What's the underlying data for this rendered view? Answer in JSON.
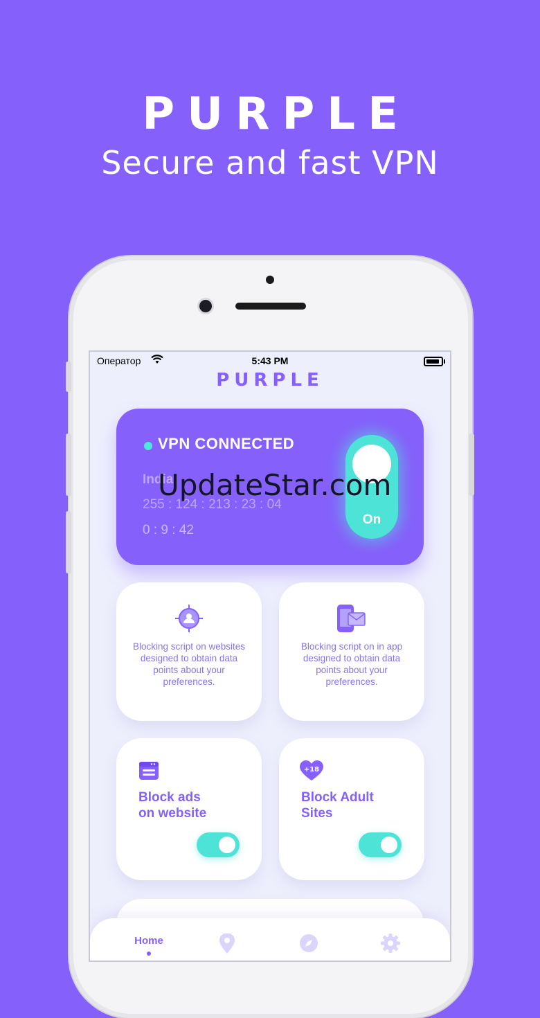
{
  "promo": {
    "brand": "PURPLE",
    "tagline": "Secure and fast VPN"
  },
  "status_bar": {
    "carrier": "Оператор",
    "time": "5:43 PM"
  },
  "app": {
    "logo": "PURPLE"
  },
  "vpn": {
    "status": "VPN CONNECTED",
    "country": "India",
    "ip": "255 : 124 : 213 : 23 : 04",
    "timer": "0 : 9 : 42",
    "toggle_label": "On",
    "toggle_on": true
  },
  "watermark": "UpdateStar.com",
  "features": [
    {
      "icon": "target-user-icon",
      "description": "Blocking script on websites designed to obtain data points about your preferences."
    },
    {
      "icon": "phone-mail-icon",
      "description": "Blocking script on in app designed to obtain data points about your preferences."
    }
  ],
  "blockers": [
    {
      "icon": "browser-window-icon",
      "title_line1": "Block ads",
      "title_line2": "on website",
      "enabled": true
    },
    {
      "icon": "heart-18-icon",
      "title_line1": "Block Adult",
      "title_line2": "Sites",
      "enabled": true,
      "badge": "+18"
    }
  ],
  "tabs": [
    {
      "label": "Home",
      "active": true,
      "icon": "home"
    },
    {
      "label": "",
      "active": false,
      "icon": "location-pin-icon"
    },
    {
      "label": "",
      "active": false,
      "icon": "compass-icon"
    },
    {
      "label": "",
      "active": false,
      "icon": "gear-icon"
    }
  ],
  "colors": {
    "brand": "#8660fb",
    "accent": "#4de3d6",
    "screen_bg": "#eeeffd"
  }
}
